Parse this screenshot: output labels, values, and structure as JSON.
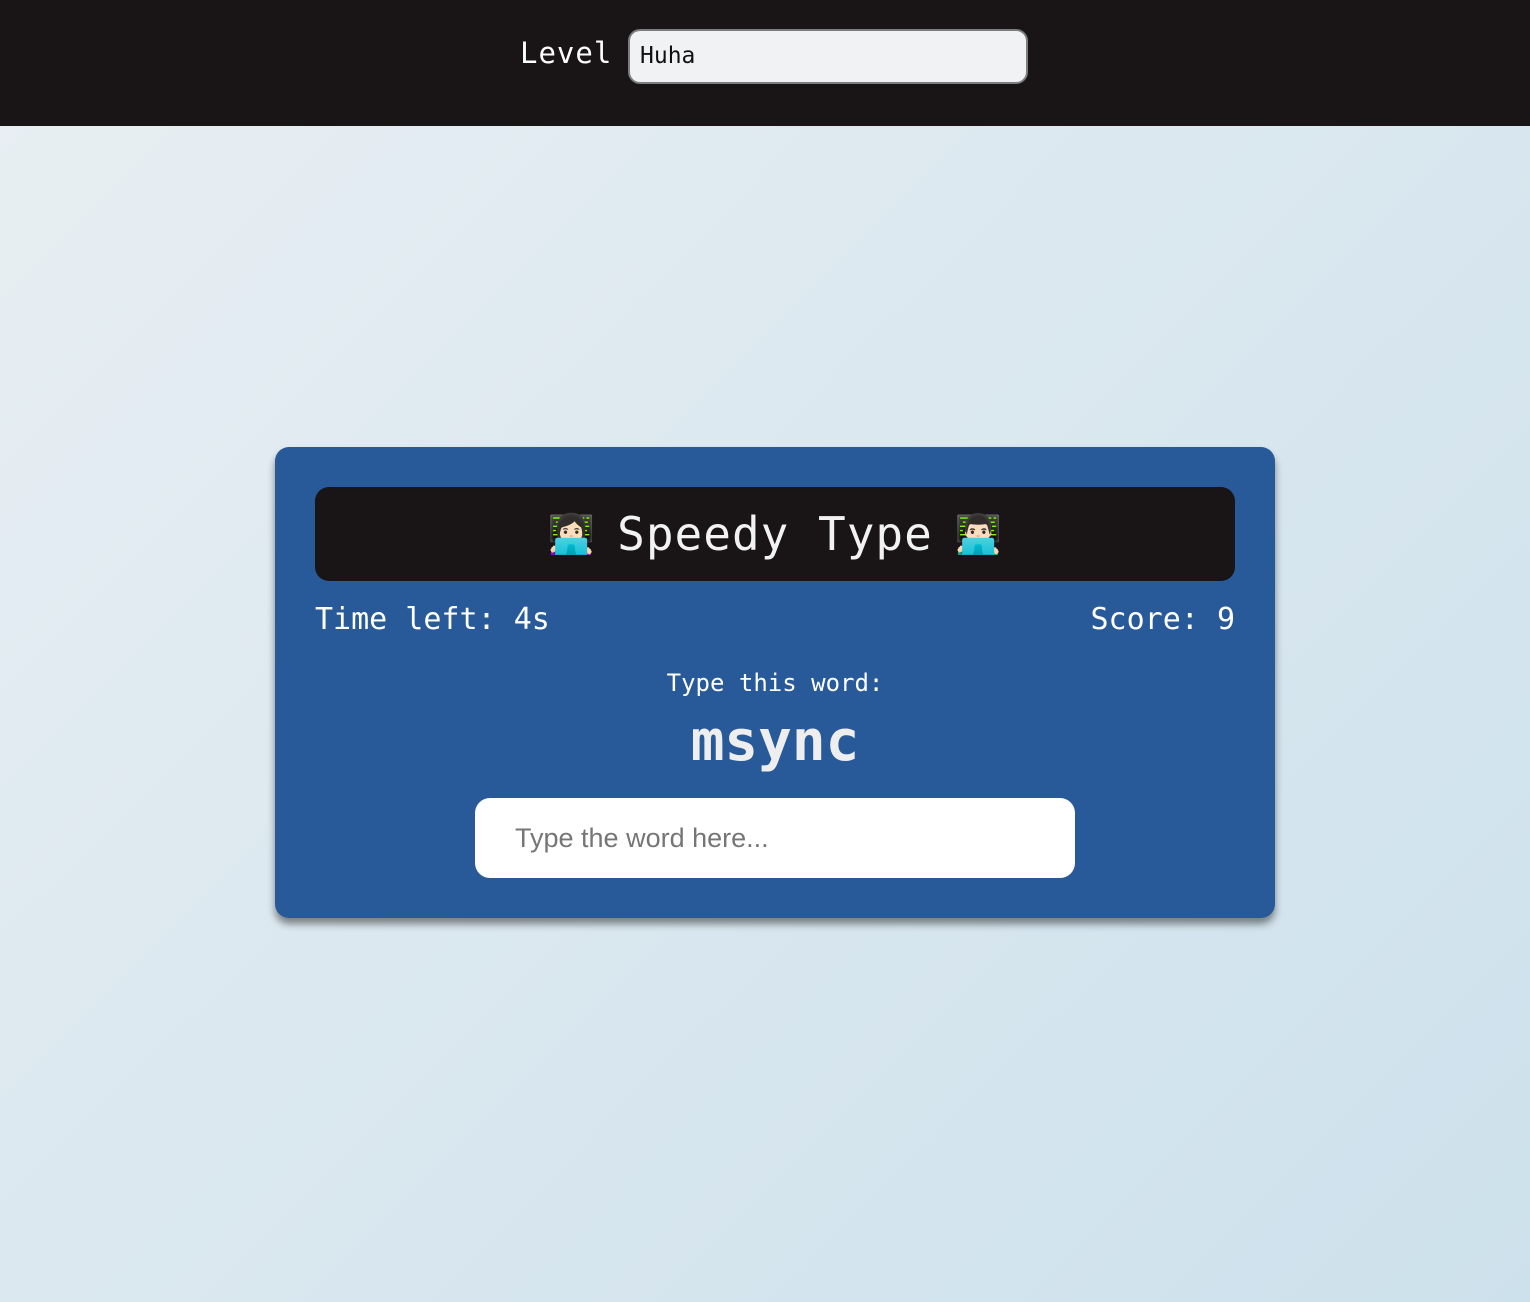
{
  "header": {
    "level_label": "Level",
    "level_value": "Huha"
  },
  "game": {
    "title": "Speedy Type",
    "left_icon": "👩🏻‍💻",
    "right_icon": "👨🏻‍💻",
    "time_left_label": "Time left:",
    "time_left_value": "4s",
    "score_label": "Score:",
    "score_value": "9",
    "prompt": "Type this word:",
    "current_word": "msync",
    "input_placeholder": "Type the word here...",
    "input_value": ""
  },
  "colors": {
    "topbar": "#191415",
    "card": "#285999",
    "title_bar": "#191415"
  }
}
